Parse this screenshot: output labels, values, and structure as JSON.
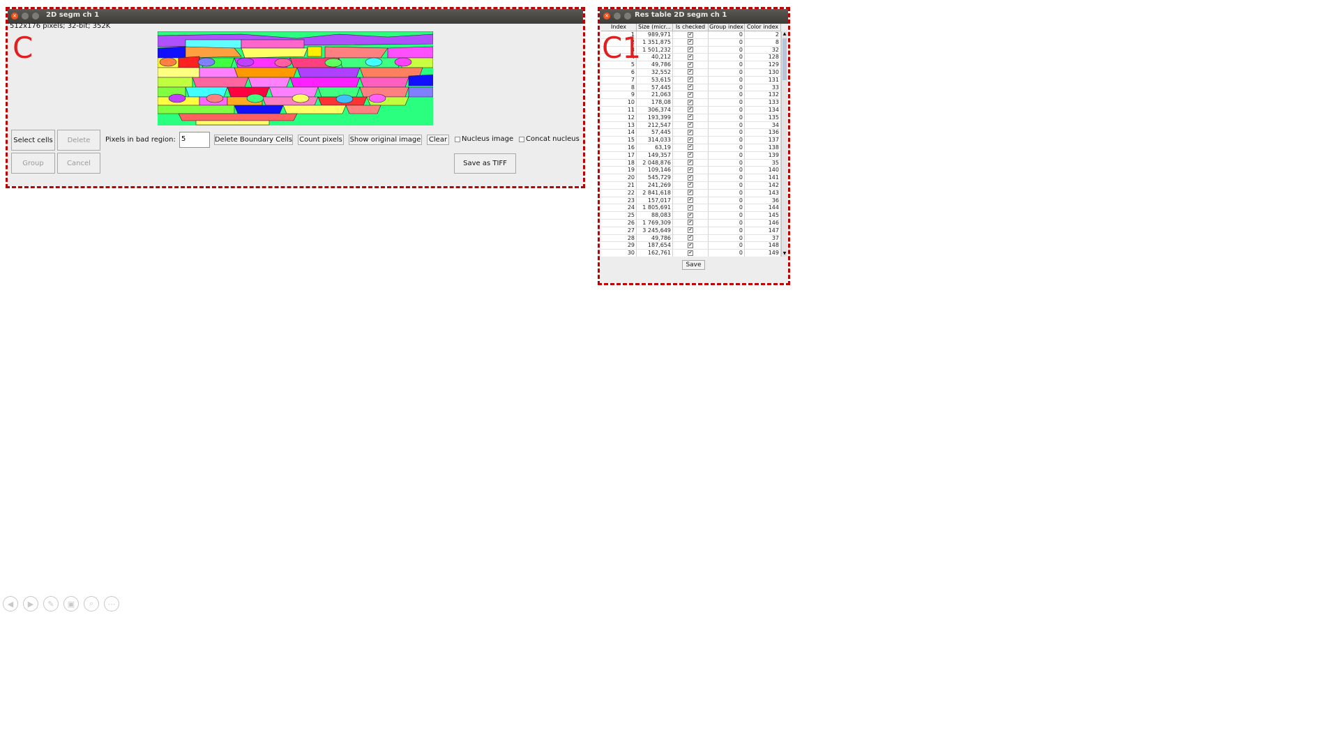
{
  "labels": {
    "panel_c": "C",
    "panel_c1": "C1"
  },
  "segm_window": {
    "title": "2D segm ch 1",
    "image_info": "512x176 pixels; 32-bit; 352K",
    "buttons": {
      "select_cells": "Select cells",
      "delete": "Delete",
      "group": "Group",
      "cancel": "Cancel",
      "delete_boundary": "Delete Boundary Cells",
      "count_pixels": "Count pixels",
      "show_original": "Show original image",
      "clear": "Clear",
      "save_tiff": "Save as TIFF"
    },
    "pixels_label": "Pixels in bad region:",
    "pixels_value": "5",
    "checkboxes": {
      "nucleus": "Nucleus image",
      "concat": "Concat nucleus"
    }
  },
  "res_window": {
    "title": "Res table 2D segm ch 1",
    "columns": [
      "Index",
      "Size (micr...",
      "Is checked",
      "Group index",
      "Color index"
    ],
    "rows": [
      [
        "1",
        "989,971",
        "0",
        "2"
      ],
      [
        "2",
        "1 351,875",
        "0",
        "8"
      ],
      [
        "3",
        "1 501,232",
        "0",
        "32"
      ],
      [
        "4",
        "40,212",
        "0",
        "128"
      ],
      [
        "5",
        "49,786",
        "0",
        "129"
      ],
      [
        "6",
        "32,552",
        "0",
        "130"
      ],
      [
        "7",
        "53,615",
        "0",
        "131"
      ],
      [
        "8",
        "57,445",
        "0",
        "33"
      ],
      [
        "9",
        "21,063",
        "0",
        "132"
      ],
      [
        "10",
        "178,08",
        "0",
        "133"
      ],
      [
        "11",
        "306,374",
        "0",
        "134"
      ],
      [
        "12",
        "193,399",
        "0",
        "135"
      ],
      [
        "13",
        "212,547",
        "0",
        "34"
      ],
      [
        "14",
        "57,445",
        "0",
        "136"
      ],
      [
        "15",
        "314,033",
        "0",
        "137"
      ],
      [
        "16",
        "63,19",
        "0",
        "138"
      ],
      [
        "17",
        "149,357",
        "0",
        "139"
      ],
      [
        "18",
        "2 048,876",
        "0",
        "35"
      ],
      [
        "19",
        "109,146",
        "0",
        "140"
      ],
      [
        "20",
        "545,729",
        "0",
        "141"
      ],
      [
        "21",
        "241,269",
        "0",
        "142"
      ],
      [
        "22",
        "2 841,618",
        "0",
        "143"
      ],
      [
        "23",
        "157,017",
        "0",
        "36"
      ],
      [
        "24",
        "1 805,691",
        "0",
        "144"
      ],
      [
        "25",
        "88,083",
        "0",
        "145"
      ],
      [
        "26",
        "1 769,309",
        "0",
        "146"
      ],
      [
        "27",
        "3 245,649",
        "0",
        "147"
      ],
      [
        "28",
        "49,786",
        "0",
        "37"
      ],
      [
        "29",
        "187,654",
        "0",
        "148"
      ],
      [
        "30",
        "162,761",
        "0",
        "149"
      ]
    ],
    "save_label": "Save"
  },
  "icons": [
    "prev-icon",
    "next-icon",
    "pen-icon",
    "slides-icon",
    "zoom-icon",
    "more-icon"
  ]
}
